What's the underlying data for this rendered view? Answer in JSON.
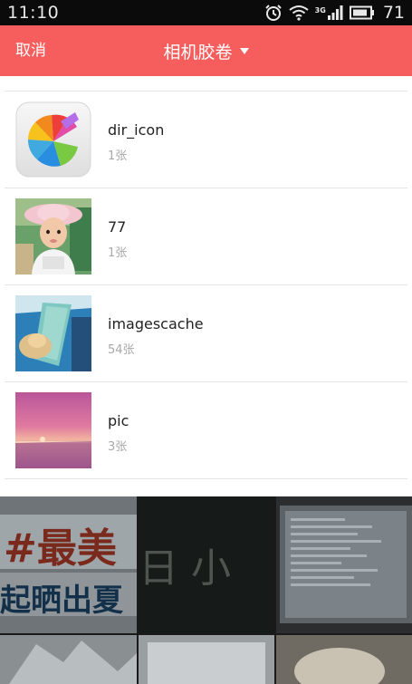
{
  "status_bar": {
    "time": "11:10",
    "network_badge": "3G",
    "battery": "71",
    "icons": [
      "alarm-icon",
      "wifi-icon",
      "signal-icon",
      "battery-icon"
    ]
  },
  "header": {
    "cancel_label": "取消",
    "title": "相机胶卷",
    "background_color": "#f65e5e",
    "title_dropdown_icon": "caret-down-icon"
  },
  "albums": [
    {
      "name": "dir_icon",
      "count": "1张"
    },
    {
      "name": "77",
      "count": "1张"
    },
    {
      "name": "imagescache",
      "count": "54张"
    },
    {
      "name": "pic",
      "count": "3张"
    }
  ],
  "gallery": {
    "tile_texts": [
      "#最美",
      "起晒出夏",
      "日 小"
    ]
  }
}
